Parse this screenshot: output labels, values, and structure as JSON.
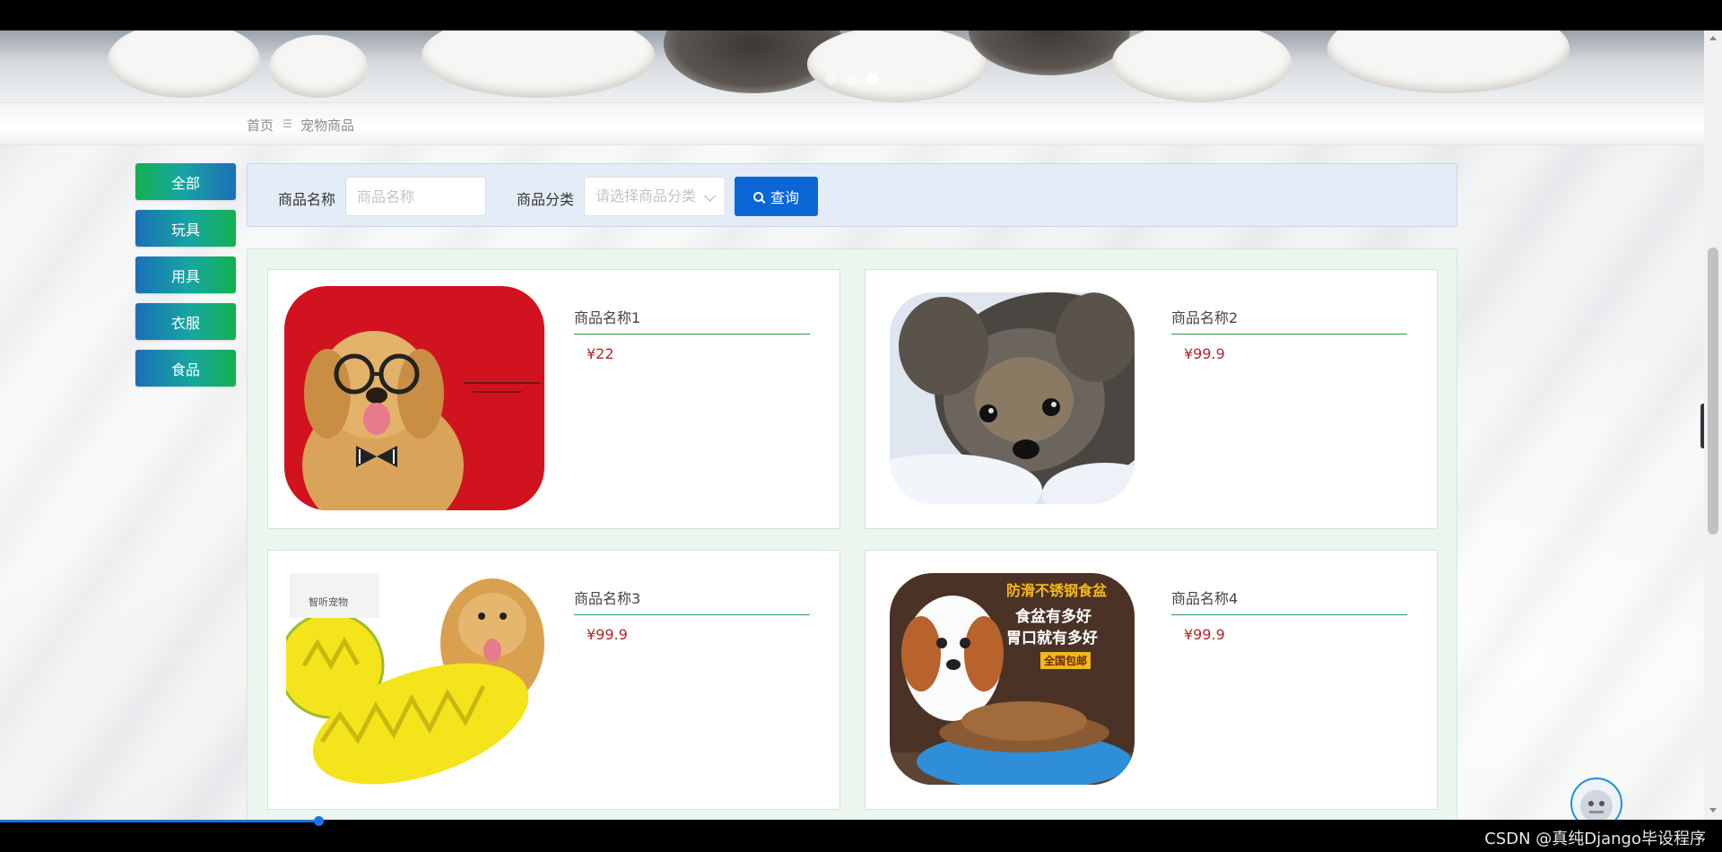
{
  "banner": {
    "dots": 3,
    "active_dot": 3
  },
  "breadcrumb": {
    "home": "首页",
    "separator": "☰",
    "current": "宠物商品"
  },
  "sidebar": {
    "items": [
      {
        "label": "全部",
        "active": true
      },
      {
        "label": "玩具",
        "active": false
      },
      {
        "label": "用具",
        "active": false
      },
      {
        "label": "衣服",
        "active": false
      },
      {
        "label": "食品",
        "active": false
      }
    ]
  },
  "search": {
    "name_label": "商品名称",
    "name_placeholder": "商品名称",
    "category_label": "商品分类",
    "category_placeholder": "请选择商品分类",
    "query_label": "查询"
  },
  "products": [
    {
      "name": "商品名称1",
      "price": "¥22",
      "image": "golden-retriever-with-glasses"
    },
    {
      "name": "商品名称2",
      "price": "¥99.9",
      "image": "yorkie-puppy"
    },
    {
      "name": "商品名称3",
      "price": "¥99.9",
      "image": "yellow-chew-toy-with-dog",
      "image_text": "智听宠物"
    },
    {
      "name": "商品名称4",
      "price": "¥99.9",
      "image": "spaniel-with-food-bowl",
      "image_text": [
        "防滑不锈钢食盆",
        "食盆有多好",
        "胃口就有多好",
        "全国包邮"
      ]
    }
  ],
  "watermark": "CSDN @真纯Django毕设程序",
  "colors": {
    "accent_blue": "#0b66d6",
    "price_red": "#b5262a",
    "divider_green": "#2a9a4a",
    "sidebar_gradient_start": "#1b6fb8",
    "sidebar_gradient_end": "#12b14f"
  }
}
